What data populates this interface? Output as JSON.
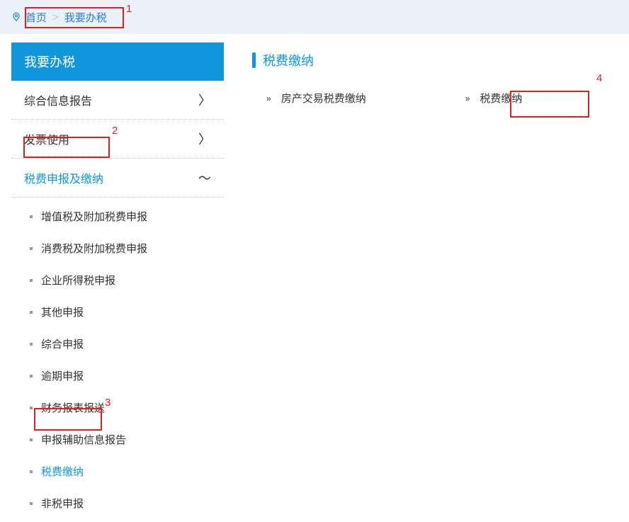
{
  "breadcrumb": {
    "home": "首页",
    "current": "我要办税"
  },
  "sidebar": {
    "header": "我要办税",
    "items": [
      {
        "label": "综合信息报告",
        "expanded": false
      },
      {
        "label": "发票使用",
        "expanded": false
      },
      {
        "label": "税费申报及缴纳",
        "expanded": true
      }
    ],
    "subitems": [
      "增值税及附加税费申报",
      "消费税及附加税费申报",
      "企业所得税申报",
      "其他申报",
      "综合申报",
      "逾期申报",
      "财务报表报送",
      "申报辅助信息报告",
      "税费缴纳",
      "非税申报"
    ]
  },
  "content": {
    "section_title": "税费缴纳",
    "links": [
      "房产交易税费缴纳",
      "税费缴纳"
    ]
  },
  "annotations": {
    "n1": "1",
    "n2": "2",
    "n3": "3",
    "n4": "4"
  }
}
